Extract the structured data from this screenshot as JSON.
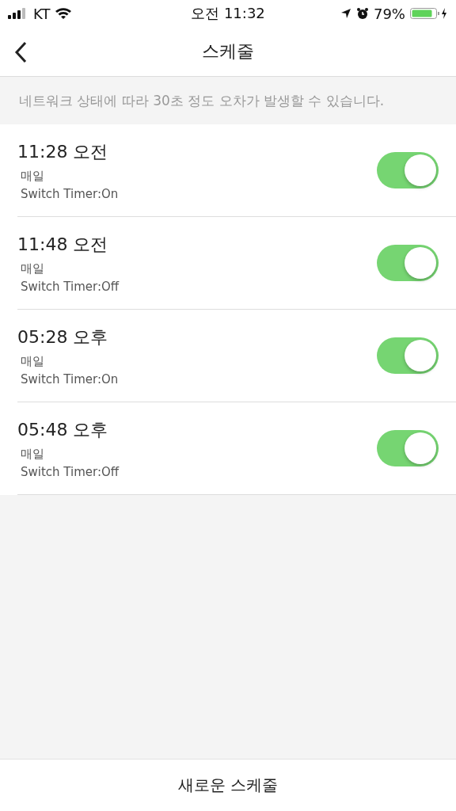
{
  "status_bar": {
    "carrier": "KT",
    "time": "오전 11:32",
    "battery": "79%"
  },
  "nav": {
    "title": "스케줄"
  },
  "notice": "네트워크 상태에 따라 30초 정도 오차가 발생할 수 있습니다.",
  "schedules": [
    {
      "time": "11:28 오전",
      "repeat": "매일",
      "action": "Switch Timer:On",
      "on": true
    },
    {
      "time": "11:48 오전",
      "repeat": "매일",
      "action": "Switch Timer:Off",
      "on": true
    },
    {
      "time": "05:28 오후",
      "repeat": "매일",
      "action": "Switch Timer:On",
      "on": true
    },
    {
      "time": "05:48 오후",
      "repeat": "매일",
      "action": "Switch Timer:Off",
      "on": true
    }
  ],
  "footer_button": "새로운 스케줄"
}
